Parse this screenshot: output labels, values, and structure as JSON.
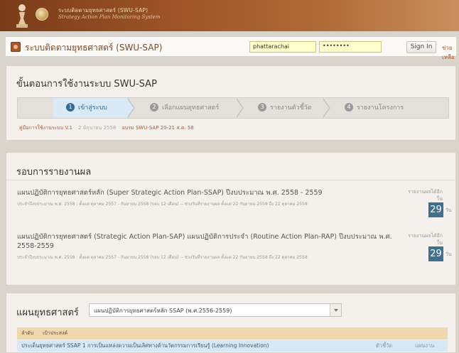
{
  "banner": {
    "title": "ระบบติดตามยุทธศาสตร์ (SWU-SAP)",
    "subtitle": "Strategy Action Plan Monitoring System"
  },
  "topbar": {
    "app_title": "ระบบติดตามยุทธศาสตร์ (SWU-SAP)",
    "username_value": "phattarachai",
    "password_value": "••••••••",
    "signin_label": "Sign In",
    "help_label": "ช่วยเหลือ"
  },
  "steps_panel": {
    "title": "ขั้นตอนการใช้งานระบบ SWU-SAP",
    "steps": [
      {
        "num": "1",
        "label": "เข้าสู่ระบบ"
      },
      {
        "num": "2",
        "label": "เลือกแผนยุทธศาสตร์"
      },
      {
        "num": "3",
        "label": "รายงานตัวชี้วัด"
      },
      {
        "num": "4",
        "label": "รายงานโครงการ"
      }
    ],
    "manual_link": "คู่มือการใช้งานระบบ V.1",
    "manual_date": "2 มิถุนายน 2558",
    "training_link": "อบรม SWU-SAP 20-21 ส.ค. 58"
  },
  "report_panel": {
    "title": "รอบการรายงานผล",
    "items": [
      {
        "title": "แผนปฏิบัติการยุทธศาสตร์หลัก (Super Strategic Action Plan-SSAP) ปีงบประมาณ พ.ศ. 2558 - 2559",
        "meta": "ประจำปีงบประมาณ พ.ศ. 2558 : ตั้งแต่ ตุลาคม 2557 - กันยายน 2558 (รอบ 12 เดือน) -- ช่วงวันที่รายงานผล ตั้งแต่ 22 กันยายน 2558 ถึง 22 ตุลาคม 2558",
        "side_label": "รายงานผลได้อีกใน",
        "days": "29",
        "unit": "วัน"
      },
      {
        "title": "แผนปฏิบัติการยุทธศาสตร์ (Strategic Action Plan-SAP) แผนปฏิบัติการประจำ (Routine Action Plan-RAP) ปีงบประมาณ พ.ศ. 2558-2559",
        "meta": "ประจำปีงบประมาณ พ.ศ. 2558 : ตั้งแต่ ตุลาคม 2557 - กันยายน 2558 (รอบ 12 เดือน) -- ช่วงวันที่รายงานผล ตั้งแต่ 22 กันยายน 2558 ถึง 22 ตุลาคม 2558",
        "side_label": "รายงานผลได้อีกใน",
        "days": "29",
        "unit": "วัน"
      }
    ]
  },
  "strategy_panel": {
    "title": "แผนยุทธศาสตร์",
    "selected_plan": "แผนปฏิบัติการยุทธศาสตร์หลัก SSAP (พ.ศ.2556-2559)",
    "table_headers": [
      "ลำดับ",
      "เป้าประสงค์"
    ],
    "row": {
      "text": "ประเด็นยุทธศาสตร์ SSAP 1 การเป็นแหล่งความเป็นเลิศทางด้านวัตกรรมการเรียนรู้ (Learning Innovation)",
      "col2": "ตัวชี้วัด",
      "col3": "แผนงาน"
    }
  }
}
